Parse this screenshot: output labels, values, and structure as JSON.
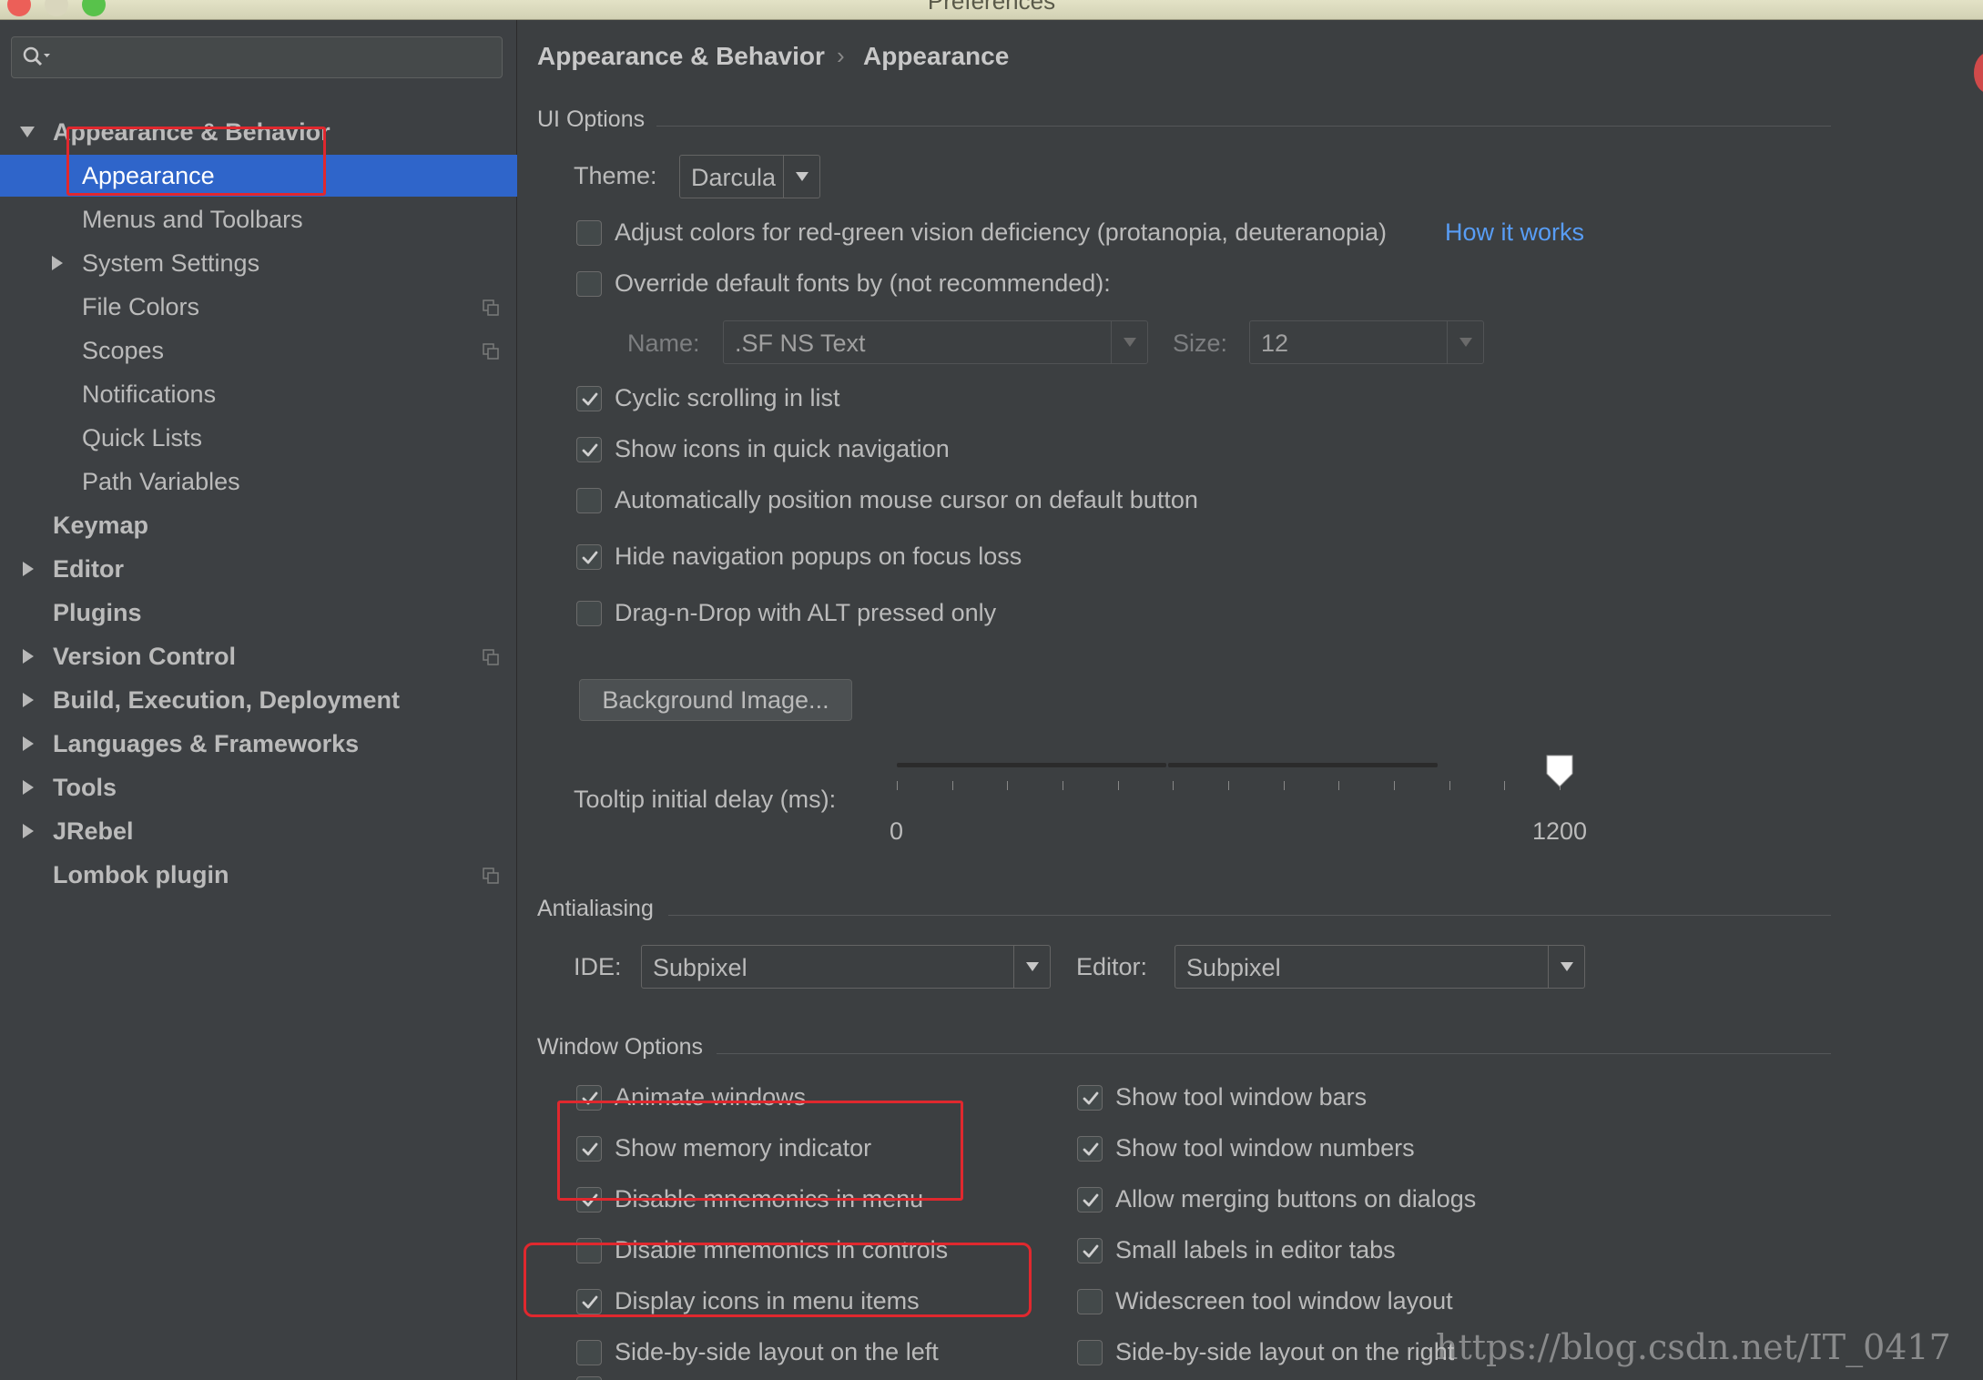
{
  "window": {
    "title": "Preferences"
  },
  "search": {
    "placeholder": ""
  },
  "sidebar": {
    "items": [
      {
        "label": "Appearance & Behavior",
        "level": 0,
        "expanded": true,
        "bold": true
      },
      {
        "label": "Appearance",
        "level": 1,
        "selected": true
      },
      {
        "label": "Menus and Toolbars",
        "level": 1
      },
      {
        "label": "System Settings",
        "level": 1,
        "collapsed": true
      },
      {
        "label": "File Colors",
        "level": 1,
        "project": true
      },
      {
        "label": "Scopes",
        "level": 1,
        "project": true
      },
      {
        "label": "Notifications",
        "level": 1
      },
      {
        "label": "Quick Lists",
        "level": 1
      },
      {
        "label": "Path Variables",
        "level": 1
      },
      {
        "label": "Keymap",
        "level": 0,
        "bold": true
      },
      {
        "label": "Editor",
        "level": 0,
        "bold": true,
        "collapsed": true
      },
      {
        "label": "Plugins",
        "level": 0,
        "bold": true
      },
      {
        "label": "Version Control",
        "level": 0,
        "bold": true,
        "collapsed": true,
        "project": true
      },
      {
        "label": "Build, Execution, Deployment",
        "level": 0,
        "bold": true,
        "collapsed": true
      },
      {
        "label": "Languages & Frameworks",
        "level": 0,
        "bold": true,
        "collapsed": true
      },
      {
        "label": "Tools",
        "level": 0,
        "bold": true,
        "collapsed": true
      },
      {
        "label": "JRebel",
        "level": 0,
        "bold": true,
        "collapsed": true
      },
      {
        "label": "Lombok plugin",
        "level": 0,
        "bold": true,
        "project": true
      }
    ]
  },
  "breadcrumb": {
    "parent": "Appearance & Behavior",
    "separator": "›",
    "current": "Appearance"
  },
  "ui_options": {
    "title": "UI Options",
    "theme_label": "Theme:",
    "theme_value": "Darcula",
    "adjust_colors": {
      "label": "Adjust colors for red-green vision deficiency (protanopia, deuteranopia)",
      "checked": false
    },
    "how_it_works": "How it works",
    "override_fonts": {
      "label": "Override default fonts by (not recommended):",
      "checked": false
    },
    "font_name_label": "Name:",
    "font_name_value": ".SF NS Text",
    "font_size_label": "Size:",
    "font_size_value": "12",
    "cyclic_scrolling": {
      "label": "Cyclic scrolling in list",
      "checked": true
    },
    "show_icons_nav": {
      "label": "Show icons in quick navigation",
      "checked": true
    },
    "auto_position_mouse": {
      "label": "Automatically position mouse cursor on default button",
      "checked": false
    },
    "hide_nav_popups": {
      "label": "Hide navigation popups on focus loss",
      "checked": true
    },
    "drag_n_drop": {
      "label": "Drag-n-Drop with ALT pressed only",
      "checked": false
    },
    "background_image_button": "Background Image...",
    "tooltip_label": "Tooltip initial delay (ms):",
    "tooltip_min": "0",
    "tooltip_max": "1200",
    "tooltip_value_fraction": 1.0
  },
  "antialiasing": {
    "title": "Antialiasing",
    "ide_label": "IDE:",
    "ide_value": "Subpixel",
    "editor_label": "Editor:",
    "editor_value": "Subpixel"
  },
  "window_options": {
    "title": "Window Options",
    "left": [
      {
        "label": "Animate windows",
        "checked": true
      },
      {
        "label": "Show memory indicator",
        "checked": true
      },
      {
        "label": "Disable mnemonics in menu",
        "checked": true
      },
      {
        "label": "Disable mnemonics in controls",
        "checked": false
      },
      {
        "label": "Display icons in menu items",
        "checked": true
      },
      {
        "label": "Side-by-side layout on the left",
        "checked": false
      }
    ],
    "right": [
      {
        "label": "Show tool window bars",
        "checked": true
      },
      {
        "label": "Show tool window numbers",
        "checked": true
      },
      {
        "label": "Allow merging buttons on dialogs",
        "checked": true
      },
      {
        "label": "Small labels in editor tabs",
        "checked": true
      },
      {
        "label": "Widescreen tool window layout",
        "checked": false
      },
      {
        "label": "Side-by-side layout on the right",
        "checked": false
      }
    ]
  },
  "watermark": "https://blog.csdn.net/IT_0417",
  "colors": {
    "selection": "#2f65ca",
    "link": "#589df6",
    "highlight": "#e0282e",
    "background": "#3c3f41"
  }
}
